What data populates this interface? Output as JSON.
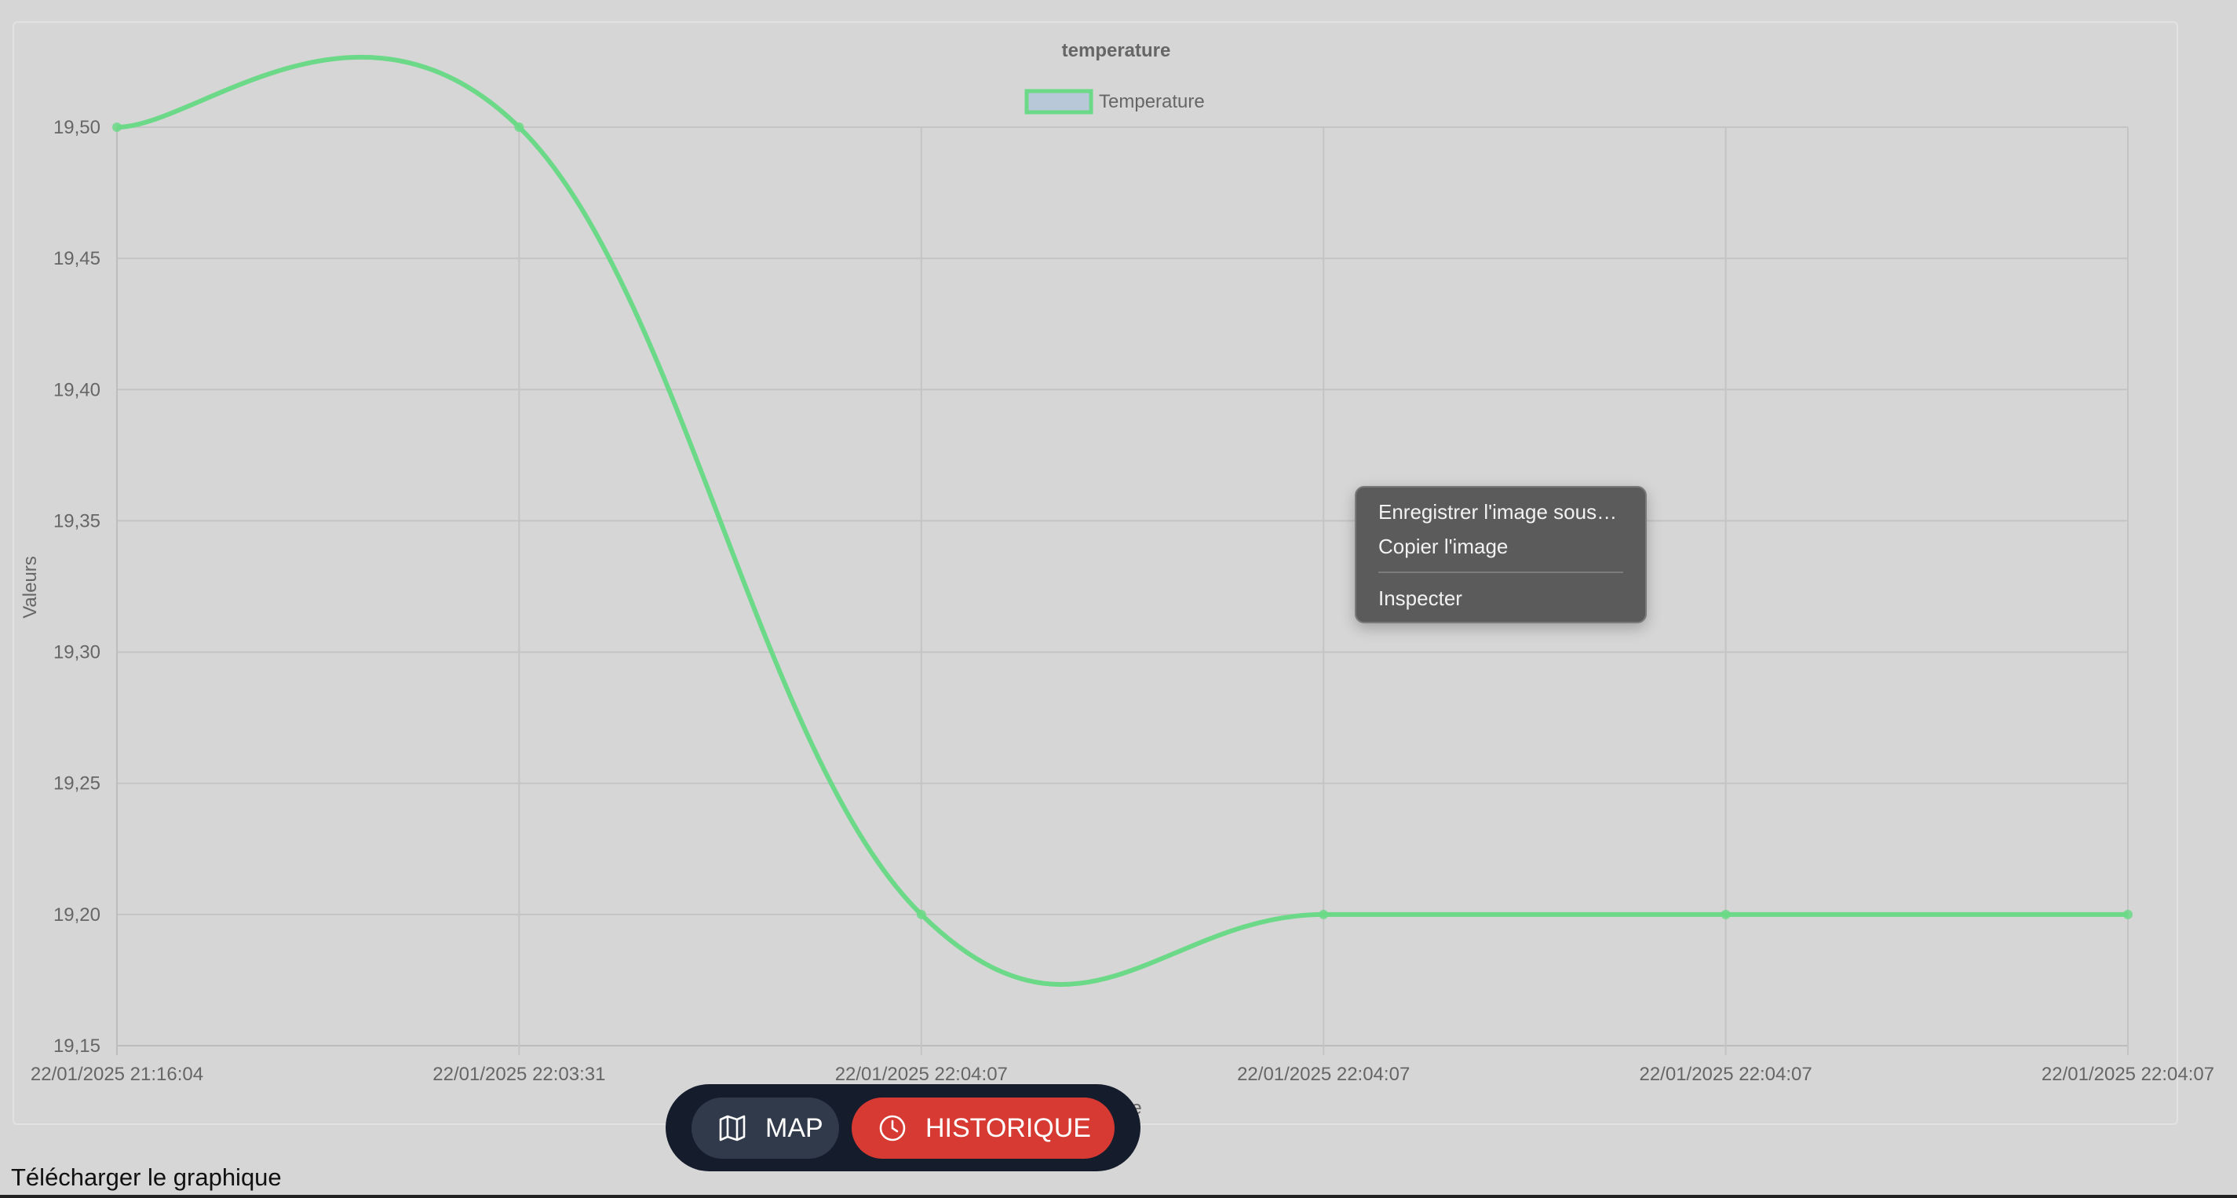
{
  "chart_data": {
    "type": "line",
    "title": "temperature",
    "xlabel": "Heure",
    "ylabel": "Valeurs",
    "categories": [
      "22/01/2025 21:16:04",
      "22/01/2025 22:03:31",
      "22/01/2025 22:04:07",
      "22/01/2025 22:04:07",
      "22/01/2025 22:04:07",
      "22/01/2025 22:04:07"
    ],
    "series": [
      {
        "name": "Temperature",
        "values": [
          19.5,
          19.5,
          19.2,
          19.2,
          19.2,
          19.2
        ],
        "color": "#6bd987"
      }
    ],
    "ylim": [
      19.15,
      19.5
    ],
    "yticks": [
      "19,50",
      "19,45",
      "19,40",
      "19,35",
      "19,30",
      "19,25",
      "19,20",
      "19,15"
    ],
    "ytick_values": [
      19.5,
      19.45,
      19.4,
      19.35,
      19.3,
      19.25,
      19.2,
      19.15
    ],
    "grid": true,
    "legend": "top-center",
    "legend_fill": "#b8c8d8",
    "smooth": true
  },
  "context_menu": {
    "items": [
      "Enregistrer l'image sous…",
      "Copier l'image",
      "Inspecter"
    ]
  },
  "nav": {
    "map_label": "MAP",
    "map_icon": "map-icon",
    "history_label": "HISTORIQUE",
    "history_icon": "clock-icon",
    "active": "HISTORIQUE"
  },
  "download_label": "Télécharger le graphique"
}
